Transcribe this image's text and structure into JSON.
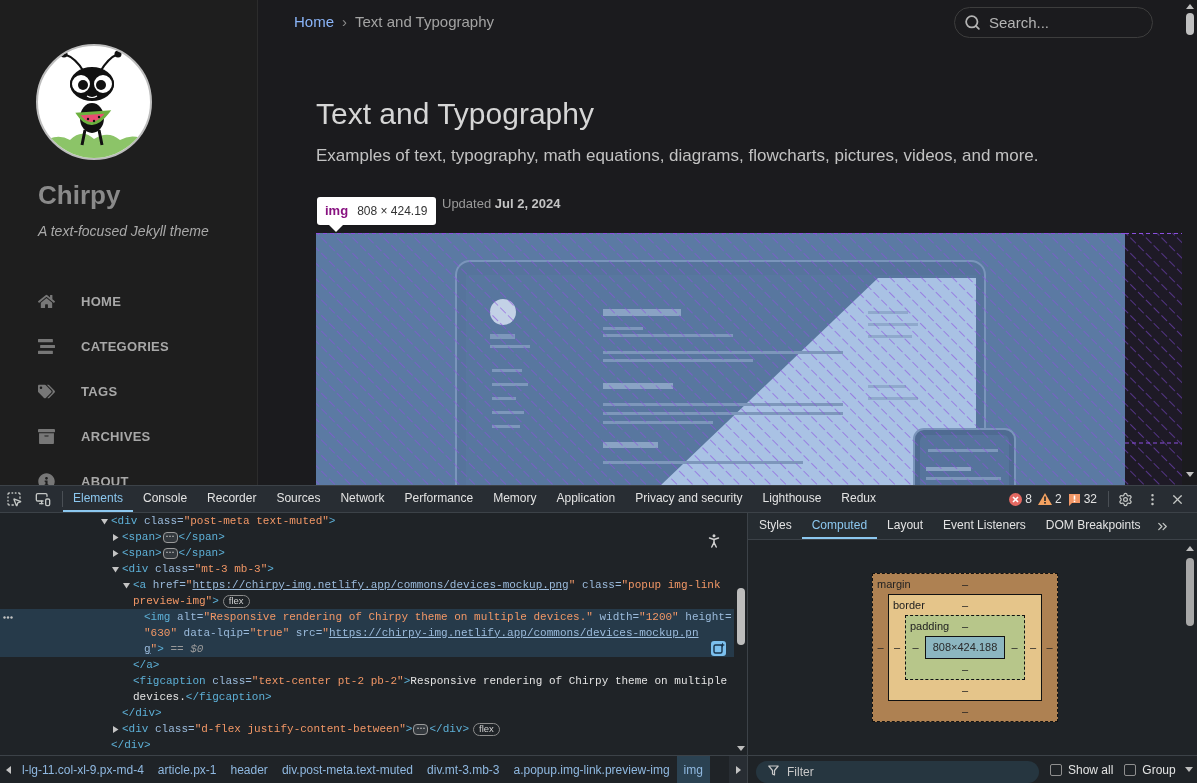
{
  "sidebar": {
    "site_title": "Chirpy",
    "tagline": "A text-focused Jekyll theme",
    "nav": [
      {
        "label": "HOME",
        "kind": "home"
      },
      {
        "label": "CATEGORIES",
        "kind": "categories"
      },
      {
        "label": "TAGS",
        "kind": "tags"
      },
      {
        "label": "ARCHIVES",
        "kind": "archives"
      },
      {
        "label": "ABOUT",
        "kind": "about"
      }
    ]
  },
  "topbar": {
    "breadcrumb": [
      {
        "label": "Home",
        "kind": "link"
      },
      {
        "label": "›",
        "kind": "separator"
      },
      {
        "label": "Text and Typography",
        "kind": "current"
      }
    ],
    "search": {
      "placeholder": "Search..."
    }
  },
  "post": {
    "title": "Text and Typography",
    "description": "Examples of text, typography, math equations, diagrams, flowcharts, pictures, videos, and more.",
    "meta": "Updated **Jul 2, 2024**"
  },
  "inspect_tooltip": {
    "tag": "img",
    "size": "808 × 424.19"
  },
  "devtools": {
    "tabs": [
      {
        "label": "Elements",
        "selected": true
      },
      {
        "label": "Console",
        "selected": false
      },
      {
        "label": "Recorder",
        "selected": false
      },
      {
        "label": "Sources",
        "selected": false
      },
      {
        "label": "Network",
        "selected": false
      },
      {
        "label": "Performance",
        "selected": false
      },
      {
        "label": "Memory",
        "selected": false
      },
      {
        "label": "Application",
        "selected": false
      },
      {
        "label": "Privacy and security",
        "selected": false
      },
      {
        "label": "Lighthouse",
        "selected": false
      },
      {
        "label": "Redux",
        "selected": false
      }
    ],
    "issues": [
      {
        "kind": "error",
        "count": "8"
      },
      {
        "kind": "warning",
        "count": "2"
      },
      {
        "kind": "info",
        "count": "32"
      }
    ],
    "dom_tree": [
      {
        "expanded": true,
        "selected": false,
        "lines": [
          [
            {
              "kind": "tag",
              "text": "<div"
            },
            {
              "kind": "attr",
              "text": " class="
            },
            {
              "kind": "value",
              "text": "\"post-meta text-muted\""
            },
            {
              "kind": "tag",
              "text": ">"
            }
          ]
        ],
        "children": [
          {
            "expanded": false,
            "selected": false,
            "lines": [
              [
                {
                  "kind": "tag",
                  "text": "<span>"
                },
                {
                  "kind": "ellipsis",
                  "text": "⋯"
                },
                {
                  "kind": "tag",
                  "text": "</span>"
                }
              ]
            ]
          },
          {
            "expanded": false,
            "selected": false,
            "lines": [
              [
                {
                  "kind": "tag",
                  "text": "<span>"
                },
                {
                  "kind": "ellipsis",
                  "text": "⋯"
                },
                {
                  "kind": "tag",
                  "text": "</span>"
                }
              ]
            ]
          },
          {
            "expanded": true,
            "selected": false,
            "lines": [
              [
                {
                  "kind": "tag",
                  "text": "<div"
                },
                {
                  "kind": "attr",
                  "text": " class="
                },
                {
                  "kind": "value",
                  "text": "\"mt-3 mb-3\""
                },
                {
                  "kind": "tag",
                  "text": ">"
                }
              ]
            ],
            "children": [
              {
                "expanded": true,
                "selected": false,
                "lines": [
                  [
                    {
                      "kind": "tag",
                      "text": "<a"
                    },
                    {
                      "kind": "attr",
                      "text": " href="
                    },
                    {
                      "kind": "value",
                      "text": "\""
                    },
                    {
                      "kind": "link",
                      "text": "https://chirpy-img.netlify.app/commons/devices-mockup.png"
                    },
                    {
                      "kind": "value",
                      "text": "\""
                    },
                    {
                      "kind": "attr",
                      "text": " class="
                    },
                    {
                      "kind": "value",
                      "text": "\"popup img-link"
                    }
                  ],
                  [
                    {
                      "kind": "value",
                      "text": "preview-img\""
                    },
                    {
                      "kind": "tag",
                      "text": ">"
                    },
                    {
                      "kind": "badge",
                      "text": "flex"
                    }
                  ]
                ],
                "children": [
                  {
                    "selected": true,
                    "lines": [
                      [
                        {
                          "kind": "tag",
                          "text": "<img"
                        },
                        {
                          "kind": "attr",
                          "text": " alt="
                        },
                        {
                          "kind": "value",
                          "text": "\"Responsive rendering of Chirpy theme on multiple devices.\""
                        },
                        {
                          "kind": "attr",
                          "text": " width="
                        },
                        {
                          "kind": "value",
                          "text": "\"1200\""
                        },
                        {
                          "kind": "attr",
                          "text": " height="
                        }
                      ],
                      [
                        {
                          "kind": "value",
                          "text": "\"630\""
                        },
                        {
                          "kind": "attr",
                          "text": " data-lqip="
                        },
                        {
                          "kind": "value",
                          "text": "\"true\""
                        },
                        {
                          "kind": "attr",
                          "text": " src="
                        },
                        {
                          "kind": "value",
                          "text": "\""
                        },
                        {
                          "kind": "link",
                          "text": "https://chirpy-img.netlify.app/commons/devices-mockup.pn"
                        }
                      ],
                      [
                        {
                          "kind": "link",
                          "text": "g"
                        },
                        {
                          "kind": "value",
                          "text": "\""
                        },
                        {
                          "kind": "tag",
                          "text": ">"
                        },
                        {
                          "kind": "hint",
                          "text": " == $0"
                        }
                      ]
                    ]
                  }
                ],
                "close": [
                  [
                    {
                      "kind": "tag",
                      "text": "</a>"
                    }
                  ]
                ]
              },
              {
                "selected": false,
                "lines": [
                  [
                    {
                      "kind": "tag",
                      "text": "<figcaption"
                    },
                    {
                      "kind": "attr",
                      "text": " class="
                    },
                    {
                      "kind": "value",
                      "text": "\"text-center pt-2 pb-2\""
                    },
                    {
                      "kind": "tag",
                      "text": ">"
                    },
                    {
                      "kind": "text",
                      "text": "Responsive rendering of Chirpy theme on multiple"
                    }
                  ],
                  [
                    {
                      "kind": "text",
                      "text": "devices."
                    },
                    {
                      "kind": "tag",
                      "text": "</figcaption>"
                    }
                  ]
                ]
              }
            ],
            "close": [
              [
                {
                  "kind": "tag",
                  "text": "</div>"
                }
              ]
            ]
          },
          {
            "expanded": false,
            "selected": false,
            "lines": [
              [
                {
                  "kind": "tag",
                  "text": "<div"
                },
                {
                  "kind": "attr",
                  "text": " class="
                },
                {
                  "kind": "value",
                  "text": "\"d-flex justify-content-between\""
                },
                {
                  "kind": "tag",
                  "text": ">"
                },
                {
                  "kind": "ellipsis",
                  "text": "⋯"
                },
                {
                  "kind": "tag",
                  "text": "</div>"
                },
                {
                  "kind": "badge",
                  "text": "flex"
                }
              ]
            ]
          }
        ],
        "close": [
          [
            {
              "kind": "tag",
              "text": "</div>"
            }
          ]
        ]
      }
    ],
    "breadcrumbs": [
      {
        "label": "l-lg-11.col-xl-9.px-md-4",
        "selected": false
      },
      {
        "label": "article.px-1",
        "selected": false
      },
      {
        "label": "header",
        "selected": false
      },
      {
        "label": "div.post-meta.text-muted",
        "selected": false
      },
      {
        "label": "div.mt-3.mb-3",
        "selected": false
      },
      {
        "label": "a.popup.img-link.preview-img",
        "selected": false
      },
      {
        "label": "img",
        "selected": true
      }
    ],
    "sidebar_tabs": [
      {
        "label": "Styles",
        "selected": false
      },
      {
        "label": "Computed",
        "selected": true
      },
      {
        "label": "Layout",
        "selected": false
      },
      {
        "label": "Event Listeners",
        "selected": false
      },
      {
        "label": "DOM Breakpoints",
        "selected": false
      }
    ],
    "box_model": {
      "layers": [
        {
          "kind": "margin",
          "label": "margin",
          "top": "–",
          "left": "–"
        },
        {
          "kind": "border",
          "label": "border",
          "top": "–",
          "left": "–"
        },
        {
          "kind": "padding",
          "label": "padding",
          "top": "–",
          "left": "–"
        }
      ],
      "content": "808×424.188",
      "right_bottom": [
        {
          "right": "–",
          "bottom": "–"
        },
        {
          "right": "–",
          "bottom": "–"
        },
        {
          "right": "–",
          "bottom": "–"
        }
      ]
    },
    "filter": {
      "placeholder": "Filter"
    },
    "options": [
      {
        "label": "Show all",
        "checked": false
      },
      {
        "label": "Group",
        "checked": false
      }
    ]
  }
}
